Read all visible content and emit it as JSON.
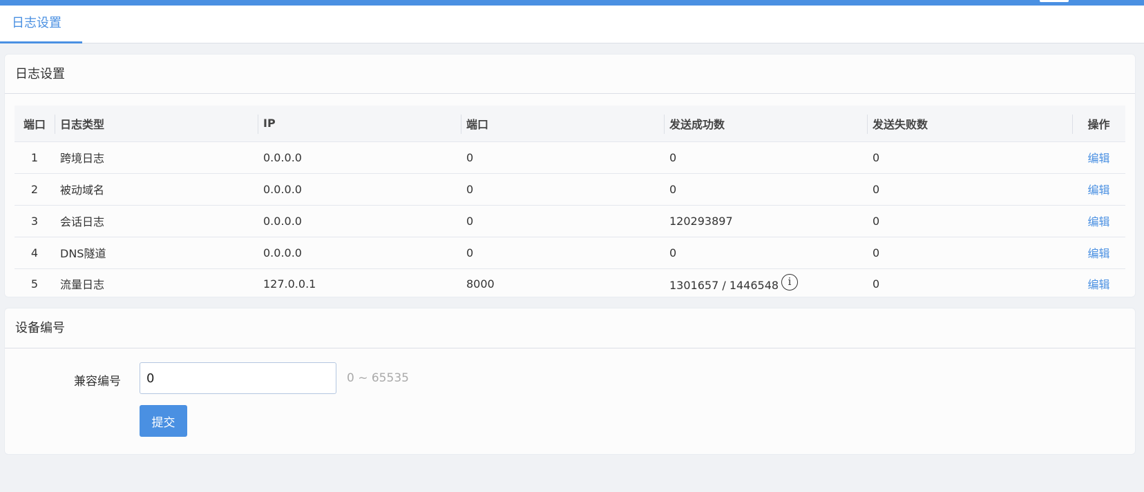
{
  "tabs": [
    {
      "label": "日志设置",
      "active": true
    }
  ],
  "log_section": {
    "title": "日志设置",
    "columns": [
      "端口",
      "日志类型",
      "IP",
      "端口",
      "发送成功数",
      "发送失败数",
      "操作"
    ],
    "rows": [
      {
        "index": "1",
        "type": "跨境日志",
        "ip": "0.0.0.0",
        "port": "0",
        "success": "0",
        "failure": "0",
        "action": "编辑"
      },
      {
        "index": "2",
        "type": "被动域名",
        "ip": "0.0.0.0",
        "port": "0",
        "success": "0",
        "failure": "0",
        "action": "编辑"
      },
      {
        "index": "3",
        "type": "会话日志",
        "ip": "0.0.0.0",
        "port": "0",
        "success": "120293897",
        "failure": "0",
        "action": "编辑"
      },
      {
        "index": "4",
        "type": "DNS隧道",
        "ip": "0.0.0.0",
        "port": "0",
        "success": "0",
        "failure": "0",
        "action": "编辑"
      },
      {
        "index": "5",
        "type": "流量日志",
        "ip": "127.0.0.1",
        "port": "8000",
        "success": "1301657 / 1446548",
        "failure": "0",
        "action": "编辑",
        "info_icon": "info-icon"
      }
    ]
  },
  "device_section": {
    "title": "设备编号",
    "field_label": "兼容编号",
    "field_value": "0",
    "field_hint": "0 ~ 65535",
    "submit_label": "提交"
  },
  "colors": {
    "accent": "#4a90e2",
    "background": "#f0f2f5",
    "card": "#fcfcfc"
  }
}
